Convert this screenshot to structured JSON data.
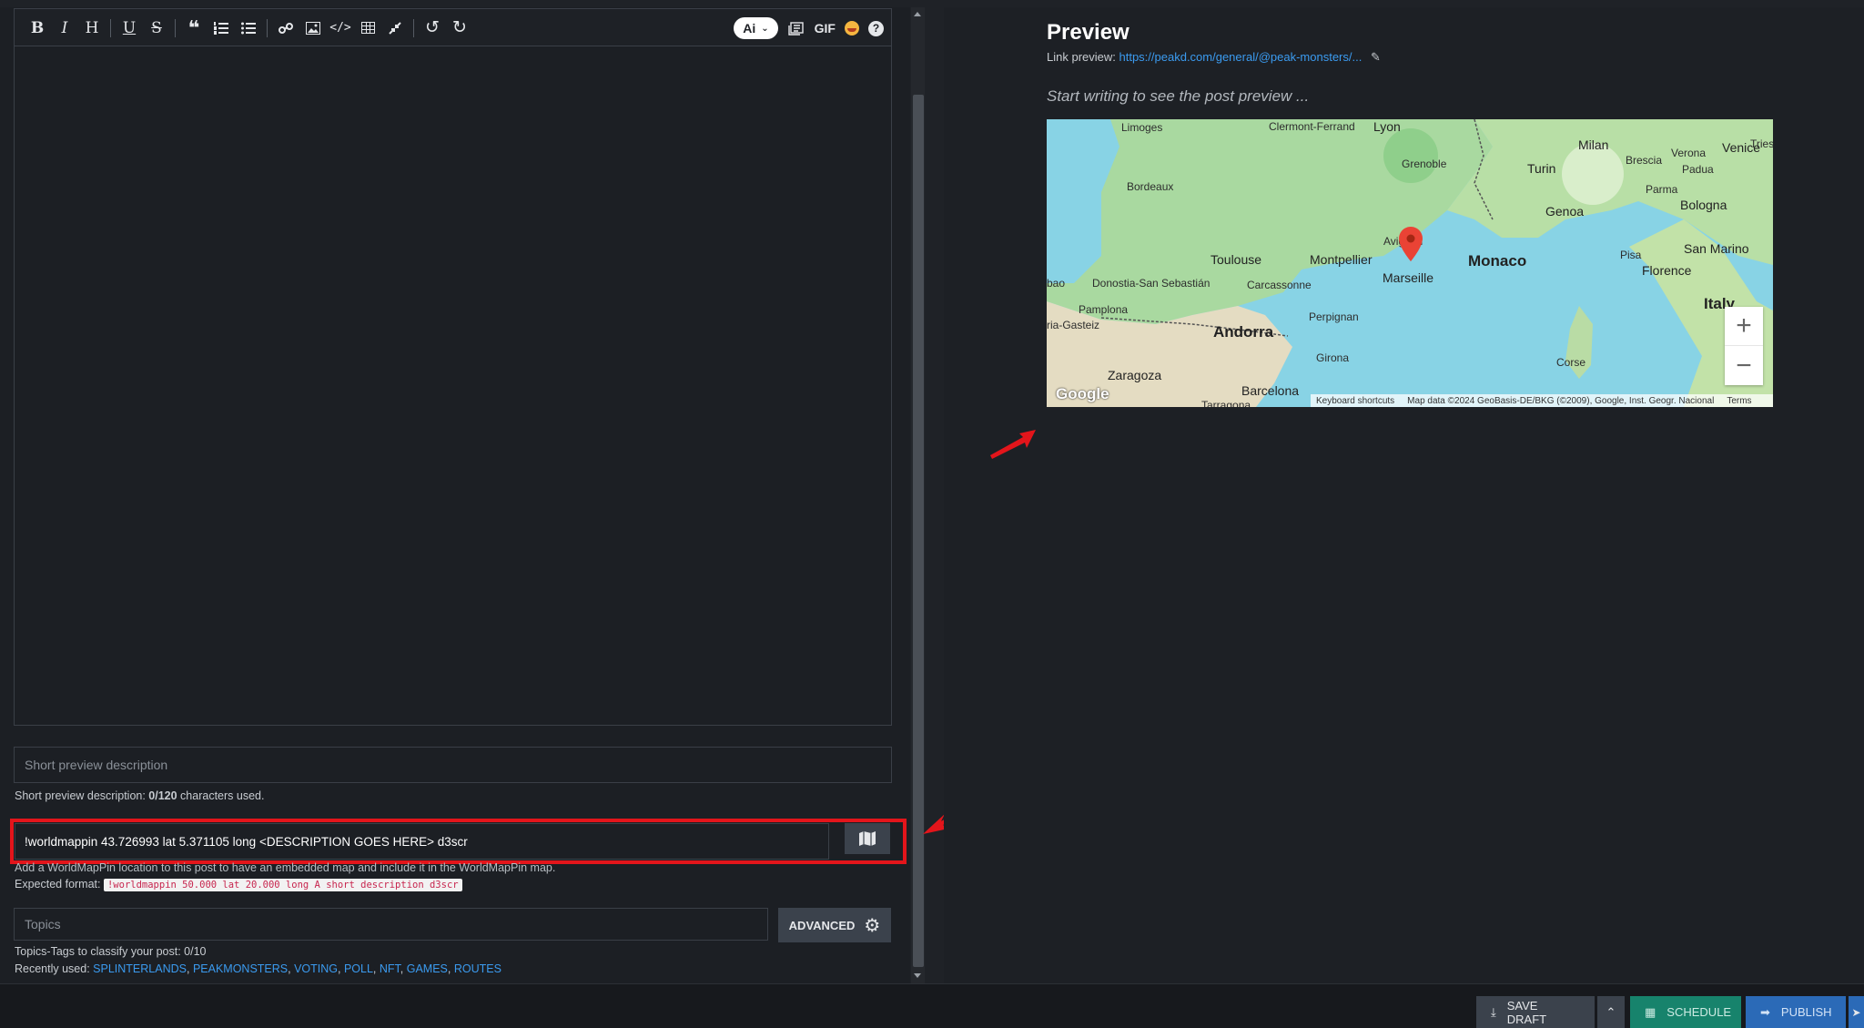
{
  "toolbar": {
    "ai_label": "Ai",
    "gif_label": "GIF"
  },
  "editor": {
    "short_desc_placeholder": "Short preview description",
    "short_desc_help_prefix": "Short preview description: ",
    "short_desc_count": "0/120",
    "short_desc_help_suffix": " characters used."
  },
  "worldmappin": {
    "value": "!worldmappin 43.726993 lat 5.371105 long <DESCRIPTION GOES HERE> d3scr",
    "help": "Add a WorldMapPin location to this post to have an embedded map and include it in the WorldMapPin map.",
    "format_label": "Expected format:",
    "format_sample": "!worldmappin 50.000 lat 20.000 long A short description d3scr"
  },
  "topics": {
    "placeholder": "Topics",
    "advanced_label": "ADVANCED",
    "help": "Topics-Tags to classify your post: 0/10",
    "recent_label": "Recently used:",
    "recent": [
      "SPLINTERLANDS",
      "PEAKMONSTERS",
      "VOTING",
      "POLL",
      "NFT",
      "GAMES",
      "ROUTES"
    ]
  },
  "preview": {
    "title": "Preview",
    "link_label": "Link preview:",
    "link_url": "https://peakd.com/general/@peak-monsters/...",
    "empty_text": "Start writing to see the post preview ..."
  },
  "map": {
    "labels": {
      "limoges": "Limoges",
      "clermont": "Clermont-Ferrand",
      "lyon": "Lyon",
      "grenoble": "Grenoble",
      "bordeaux": "Bordeaux",
      "toulouse": "Toulouse",
      "montpellier": "Montpellier",
      "avignon": "Avignon",
      "marseille": "Marseille",
      "monaco": "Monaco",
      "carcassonne": "Carcassonne",
      "donostia": "Donostia-San\nSebastián",
      "pamplona": "Pamplona",
      "vitoria": "ria-Gasteiz",
      "perpignan": "Perpignan",
      "andorra": "Andorra",
      "girona": "Girona",
      "zaragoza": "Zaragoza",
      "barcelona": "Barcelona",
      "tarragona": "Tarragona",
      "milan": "Milan",
      "brescia": "Brescia",
      "verona": "Verona",
      "venice": "Venice",
      "trieste": "Triest",
      "padua": "Padua",
      "turin": "Turin",
      "parma": "Parma",
      "genoa": "Genoa",
      "bologna": "Bologna",
      "pisa": "Pisa",
      "florence": "Florence",
      "san_marino": "San Marino",
      "italy": "Italy",
      "corse": "Corse",
      "bao": "bao"
    },
    "attrib_shortcuts": "Keyboard shortcuts",
    "attrib_data": "Map data ©2024 GeoBasis-DE/BKG (©2009), Google, Inst. Geogr. Nacional",
    "attrib_terms": "Terms",
    "google": "Google"
  },
  "bottom_bar": {
    "save_draft": "SAVE DRAFT",
    "schedule": "SCHEDULE",
    "publish": "PUBLISH"
  }
}
